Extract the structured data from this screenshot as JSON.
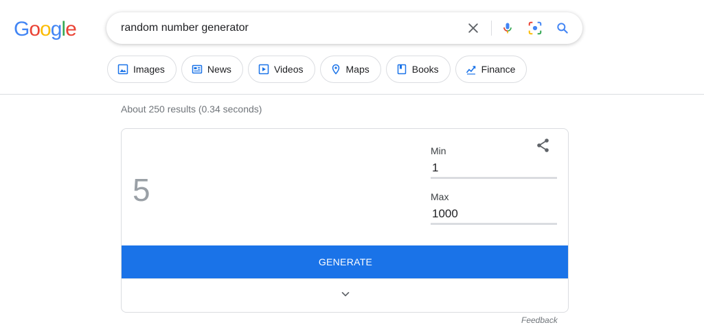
{
  "logo": {
    "letters": [
      "G",
      "o",
      "o",
      "g",
      "l",
      "e"
    ],
    "colors": [
      "#4285F4",
      "#EA4335",
      "#FBBC05",
      "#4285F4",
      "#34A853",
      "#EA4335"
    ]
  },
  "search": {
    "query": "random number generator",
    "icons": [
      "close-icon",
      "microphone-icon",
      "camera-lens-icon",
      "search-icon"
    ]
  },
  "chips": [
    {
      "label": "Images",
      "icon": "image-icon"
    },
    {
      "label": "News",
      "icon": "newspaper-icon"
    },
    {
      "label": "Videos",
      "icon": "play-icon"
    },
    {
      "label": "Maps",
      "icon": "map-pin-icon"
    },
    {
      "label": "Books",
      "icon": "book-icon"
    },
    {
      "label": "Finance",
      "icon": "finance-icon"
    }
  ],
  "stats": "About 250 results (0.34 seconds)",
  "rng": {
    "result": "5",
    "min_label": "Min",
    "min_value": "1",
    "max_label": "Max",
    "max_value": "1000",
    "generate_label": "GENERATE"
  },
  "feedback": "Feedback",
  "colors": {
    "accent": "#1a73e8",
    "border": "#dadce0",
    "muted": "#70757a"
  }
}
